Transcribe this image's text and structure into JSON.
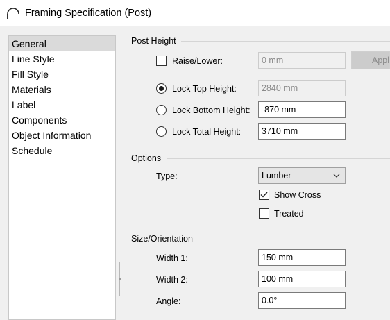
{
  "window": {
    "title": "Framing Specification (Post)"
  },
  "sidebar": {
    "items": [
      {
        "label": "General",
        "selected": true
      },
      {
        "label": "Line Style"
      },
      {
        "label": "Fill Style"
      },
      {
        "label": "Materials"
      },
      {
        "label": "Label"
      },
      {
        "label": "Components"
      },
      {
        "label": "Object Information"
      },
      {
        "label": "Schedule"
      }
    ]
  },
  "post_height": {
    "title": "Post Height",
    "raise_lower": {
      "label": "Raise/Lower:",
      "value": "0 mm",
      "checked": false,
      "apply_label": "Apply"
    },
    "lock_top": {
      "label": "Lock Top Height:",
      "value": "2840 mm",
      "selected": true
    },
    "lock_bottom": {
      "label": "Lock Bottom Height:",
      "value": "-870 mm",
      "selected": false
    },
    "lock_total": {
      "label": "Lock Total Height:",
      "value": "3710 mm",
      "selected": false
    }
  },
  "options": {
    "title": "Options",
    "type_label": "Type:",
    "type_value": "Lumber",
    "show_cross": {
      "label": "Show Cross",
      "checked": true
    },
    "treated": {
      "label": "Treated",
      "checked": false
    }
  },
  "size_orientation": {
    "title": "Size/Orientation",
    "width1": {
      "label": "Width 1:",
      "value": "150 mm"
    },
    "width2": {
      "label": "Width 2:",
      "value": "100 mm"
    },
    "angle": {
      "label": "Angle:",
      "value": "0.0°"
    }
  }
}
